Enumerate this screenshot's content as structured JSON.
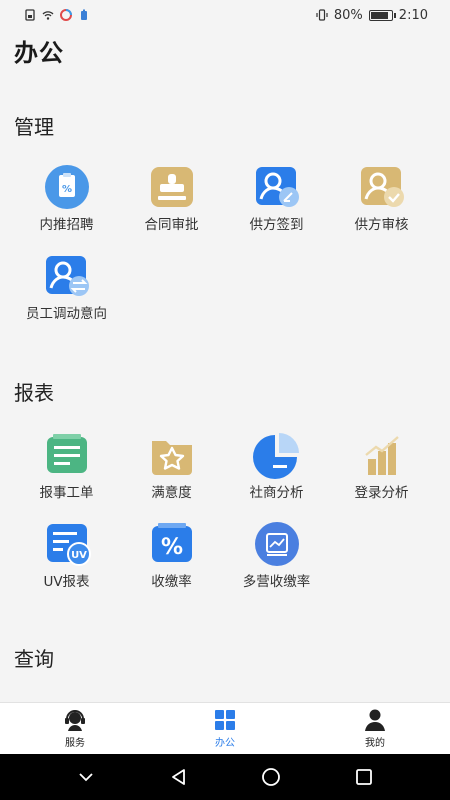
{
  "status_bar": {
    "battery": "80%",
    "battery_level": 0.8,
    "time": "2:10"
  },
  "page_title": "办公",
  "sections": [
    {
      "title": "管理",
      "items": [
        {
          "label": "内推招聘",
          "icon": "referral-recruit-icon",
          "color": "#4a98e8"
        },
        {
          "label": "合同审批",
          "icon": "contract-stamp-icon",
          "color": "#d8b874"
        },
        {
          "label": "供方签到",
          "icon": "supplier-checkin-icon",
          "color": "#2b7de9"
        },
        {
          "label": "供方审核",
          "icon": "supplier-review-icon",
          "color": "#d8b874"
        },
        {
          "label": "员工调动意向",
          "icon": "employee-transfer-icon",
          "color": "#2b7de9"
        }
      ]
    },
    {
      "title": "报表",
      "items": [
        {
          "label": "报事工单",
          "icon": "work-order-icon",
          "color": "#4cb583"
        },
        {
          "label": "满意度",
          "icon": "satisfaction-star-icon",
          "color": "#d8b874"
        },
        {
          "label": "社商分析",
          "icon": "pie-chart-icon",
          "color": "#2b7de9"
        },
        {
          "label": "登录分析",
          "icon": "bar-chart-icon",
          "color": "#d8b874"
        },
        {
          "label": "UV报表",
          "icon": "uv-report-icon",
          "color": "#2b7de9"
        },
        {
          "label": "收缴率",
          "icon": "percent-icon",
          "color": "#2b7de9"
        },
        {
          "label": "多营收缴率",
          "icon": "multi-revenue-icon",
          "color": "#4a7fe0"
        }
      ]
    },
    {
      "title": "查询",
      "items": []
    }
  ],
  "tabbar": [
    {
      "label": "服务",
      "icon": "service-icon",
      "active": false
    },
    {
      "label": "办公",
      "icon": "office-grid-icon",
      "active": true
    },
    {
      "label": "我的",
      "icon": "profile-icon",
      "active": false
    }
  ],
  "colors": {
    "accent": "#2b7de9",
    "gold": "#d8b874",
    "green": "#4cb583"
  }
}
